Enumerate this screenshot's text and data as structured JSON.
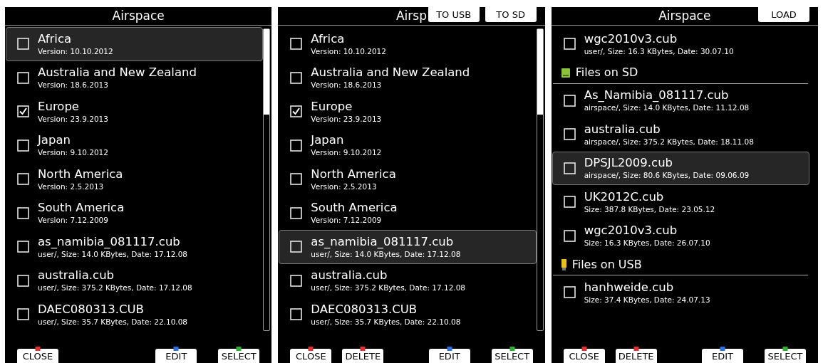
{
  "panels": [
    {
      "title": "Airspace",
      "scrollbar": true,
      "items": [
        {
          "kind": "file",
          "name": "Africa",
          "details": "Version: 10.10.2012",
          "checked": false,
          "selected": true
        },
        {
          "kind": "file",
          "name": "Australia and New Zealand",
          "details": "Version: 18.6.2013",
          "checked": false,
          "selected": false
        },
        {
          "kind": "file",
          "name": "Europe",
          "details": "Version: 23.9.2013",
          "checked": true,
          "selected": false
        },
        {
          "kind": "file",
          "name": "Japan",
          "details": "Version: 9.10.2012",
          "checked": false,
          "selected": false
        },
        {
          "kind": "file",
          "name": "North America",
          "details": "Version: 2.5.2013",
          "checked": false,
          "selected": false
        },
        {
          "kind": "file",
          "name": "South America",
          "details": "Version: 7.12.2009",
          "checked": false,
          "selected": false
        },
        {
          "kind": "file",
          "name": "as_namibia_081117.cub",
          "details": "user/, Size: 14.0 KBytes, Date: 17.12.08",
          "checked": false,
          "selected": false
        },
        {
          "kind": "file",
          "name": "australia.cub",
          "details": "user/, Size: 375.2 KBytes, Date: 17.12.08",
          "checked": false,
          "selected": false
        },
        {
          "kind": "file",
          "name": "DAEC080313.CUB",
          "details": "user/, Size: 35.7 KBytes, Date: 22.10.08",
          "checked": false,
          "selected": false
        }
      ],
      "footer": {
        "left": [
          {
            "label": "CLOSE",
            "color": "#e03030"
          }
        ],
        "right": [
          {
            "label": "EDIT",
            "color": "#3070e0"
          },
          {
            "label": "SELECT",
            "color": "#30b030"
          }
        ]
      }
    },
    {
      "title": "Airsp",
      "header_buttons": [
        "TO USB",
        "TO SD"
      ],
      "scrollbar": true,
      "items": [
        {
          "kind": "file",
          "name": "Africa",
          "details": "Version: 10.10.2012",
          "checked": false,
          "selected": false
        },
        {
          "kind": "file",
          "name": "Australia and New Zealand",
          "details": "Version: 18.6.2013",
          "checked": false,
          "selected": false
        },
        {
          "kind": "file",
          "name": "Europe",
          "details": "Version: 23.9.2013",
          "checked": true,
          "selected": false
        },
        {
          "kind": "file",
          "name": "Japan",
          "details": "Version: 9.10.2012",
          "checked": false,
          "selected": false
        },
        {
          "kind": "file",
          "name": "North America",
          "details": "Version: 2.5.2013",
          "checked": false,
          "selected": false
        },
        {
          "kind": "file",
          "name": "South America",
          "details": "Version: 7.12.2009",
          "checked": false,
          "selected": false
        },
        {
          "kind": "file",
          "name": "as_namibia_081117.cub",
          "details": "user/, Size: 14.0 KBytes, Date: 17.12.08",
          "checked": false,
          "selected": true
        },
        {
          "kind": "file",
          "name": "australia.cub",
          "details": "user/, Size: 375.2 KBytes, Date: 17.12.08",
          "checked": false,
          "selected": false
        },
        {
          "kind": "file",
          "name": "DAEC080313.CUB",
          "details": "user/, Size: 35.7 KBytes, Date: 22.10.08",
          "checked": false,
          "selected": false
        }
      ],
      "footer": {
        "left": [
          {
            "label": "CLOSE",
            "color": "#e03030"
          },
          {
            "label": "DELETE",
            "color": "#e03030"
          }
        ],
        "right": [
          {
            "label": "EDIT",
            "color": "#3070e0"
          },
          {
            "label": "SELECT",
            "color": "#30b030"
          }
        ]
      }
    },
    {
      "title": "Airspace",
      "header_buttons": [
        "LOAD"
      ],
      "scrollbar": false,
      "items": [
        {
          "kind": "file",
          "name": "wgc2010v3.cub",
          "details": "user/, Size: 16.3 KBytes, Date: 30.07.10",
          "checked": false,
          "selected": false
        },
        {
          "kind": "sd_section",
          "label": "Files on SD"
        },
        {
          "kind": "file",
          "name": "As_Namibia_081117.cub",
          "details": "airspace/, Size: 14.0 KBytes, Date: 11.12.08",
          "checked": false,
          "selected": false
        },
        {
          "kind": "file",
          "name": "australia.cub",
          "details": "airspace/, Size: 375.2 KBytes, Date: 18.11.08",
          "checked": false,
          "selected": false
        },
        {
          "kind": "file",
          "name": "DPSJL2009.cub",
          "details": "airspace/, Size: 80.6 KBytes, Date: 09.06.09",
          "checked": false,
          "selected": true
        },
        {
          "kind": "file",
          "name": "UK2012C.cub",
          "details": "Size: 387.8 KBytes, Date: 23.05.12",
          "checked": false,
          "selected": false
        },
        {
          "kind": "file",
          "name": "wgc2010v3.cub",
          "details": "Size: 16.3 KBytes, Date: 26.07.10",
          "checked": false,
          "selected": false
        },
        {
          "kind": "usb_section",
          "label": "Files on USB"
        },
        {
          "kind": "file",
          "name": "hanhweide.cub",
          "details": "Size: 37.4 KBytes, Date: 24.07.13",
          "checked": false,
          "selected": false
        }
      ],
      "footer": {
        "left": [
          {
            "label": "CLOSE",
            "color": "#e03030"
          },
          {
            "label": "DELETE",
            "color": "#e03030"
          }
        ],
        "right": [
          {
            "label": "EDIT",
            "color": "#3070e0"
          },
          {
            "label": "SELECT",
            "color": "#30b030"
          }
        ]
      }
    }
  ]
}
